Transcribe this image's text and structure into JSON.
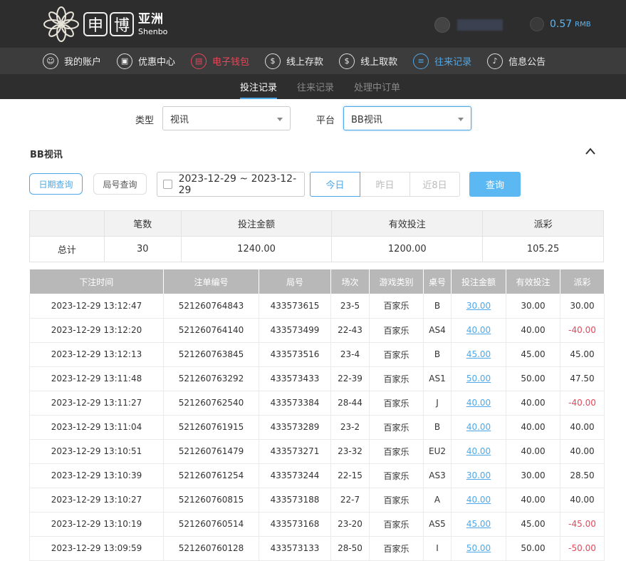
{
  "header": {
    "logo_char_1": "申",
    "logo_char_2": "博",
    "logo_cn": "亚洲",
    "logo_en": "Shenbo",
    "balance": "0.57",
    "currency": "RMB"
  },
  "nav": [
    {
      "label": "我的账户",
      "icon": "user-icon",
      "state": "normal"
    },
    {
      "label": "优惠中心",
      "icon": "gift-icon",
      "state": "normal"
    },
    {
      "label": "电子钱包",
      "icon": "wallet-icon",
      "state": "red"
    },
    {
      "label": "线上存款",
      "icon": "deposit-icon",
      "state": "normal"
    },
    {
      "label": "线上取款",
      "icon": "withdraw-icon",
      "state": "normal"
    },
    {
      "label": "往来记录",
      "icon": "records-icon",
      "state": "blue"
    },
    {
      "label": "信息公告",
      "icon": "bell-icon",
      "state": "normal"
    }
  ],
  "subtabs": [
    {
      "label": "投注记录",
      "active": true
    },
    {
      "label": "往来记录",
      "active": false
    },
    {
      "label": "处理中订单",
      "active": false
    }
  ],
  "filters": {
    "type_label": "类型",
    "type_value": "视讯",
    "platform_label": "平台",
    "platform_value": "BB视讯"
  },
  "section_title": "BB视讯",
  "query": {
    "date_query": "日期查询",
    "round_query": "局号查询",
    "date_range": "2023-12-29 ~ 2023-12-29",
    "seg_today": "今日",
    "seg_yesterday": "昨日",
    "seg_8days": "近8日",
    "submit": "查询"
  },
  "summary": {
    "headers": [
      "",
      "笔数",
      "投注金额",
      "有效投注",
      "派彩"
    ],
    "row": [
      "总计",
      "30",
      "1240.00",
      "1200.00",
      "105.25"
    ]
  },
  "detail": {
    "headers": [
      "下注时间",
      "注单编号",
      "局号",
      "场次",
      "游戏类别",
      "桌号",
      "投注金额",
      "有效投注",
      "派彩"
    ],
    "rows": [
      [
        "2023-12-29 13:12:47",
        "521260764843",
        "433573615",
        "23-5",
        "百家乐",
        "B",
        "30.00",
        "30.00",
        "30.00"
      ],
      [
        "2023-12-29 13:12:20",
        "521260764140",
        "433573499",
        "22-43",
        "百家乐",
        "AS4",
        "40.00",
        "40.00",
        "-40.00"
      ],
      [
        "2023-12-29 13:12:13",
        "521260763845",
        "433573516",
        "23-4",
        "百家乐",
        "B",
        "45.00",
        "45.00",
        "45.00"
      ],
      [
        "2023-12-29 13:11:48",
        "521260763292",
        "433573433",
        "22-39",
        "百家乐",
        "AS1",
        "50.00",
        "50.00",
        "47.50"
      ],
      [
        "2023-12-29 13:11:27",
        "521260762540",
        "433573384",
        "28-44",
        "百家乐",
        "J",
        "40.00",
        "40.00",
        "-40.00"
      ],
      [
        "2023-12-29 13:11:04",
        "521260761915",
        "433573289",
        "23-2",
        "百家乐",
        "B",
        "40.00",
        "40.00",
        "40.00"
      ],
      [
        "2023-12-29 13:10:51",
        "521260761479",
        "433573271",
        "23-32",
        "百家乐",
        "EU2",
        "40.00",
        "40.00",
        "40.00"
      ],
      [
        "2023-12-29 13:10:39",
        "521260761254",
        "433573244",
        "22-15",
        "百家乐",
        "AS3",
        "30.00",
        "30.00",
        "28.50"
      ],
      [
        "2023-12-29 13:10:27",
        "521260760815",
        "433573188",
        "22-7",
        "百家乐",
        "A",
        "40.00",
        "40.00",
        "40.00"
      ],
      [
        "2023-12-29 13:10:19",
        "521260760514",
        "433573168",
        "23-20",
        "百家乐",
        "AS5",
        "45.00",
        "45.00",
        "-45.00"
      ],
      [
        "2023-12-29 13:09:59",
        "521260760128",
        "433573133",
        "28-50",
        "百家乐",
        "I",
        "50.00",
        "50.00",
        "-50.00"
      ]
    ]
  }
}
